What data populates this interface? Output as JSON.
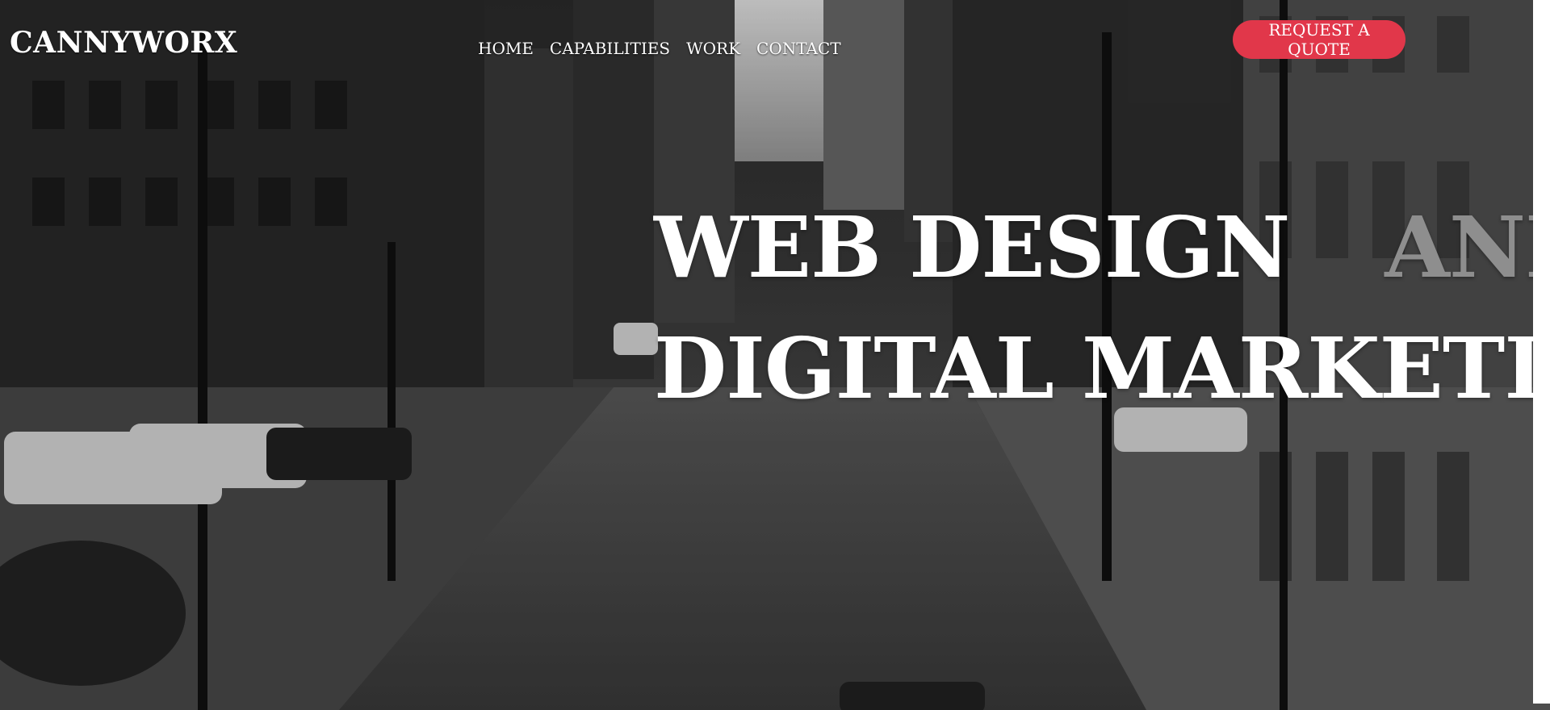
{
  "brand": {
    "logo_text": "CANNYWORX"
  },
  "nav": {
    "items": [
      {
        "label": "HOME"
      },
      {
        "label": "CAPABILITIES"
      },
      {
        "label": "WORK"
      },
      {
        "label": "CONTACT"
      }
    ]
  },
  "cta": {
    "label": "REQUEST A QUOTE",
    "color": "#e1374a"
  },
  "hero": {
    "line1_main": "WEB DESIGN",
    "line1_dim": "AND",
    "line2": "DIGITAL MARKETING",
    "background_image": "black-and-white city street with buildings"
  }
}
